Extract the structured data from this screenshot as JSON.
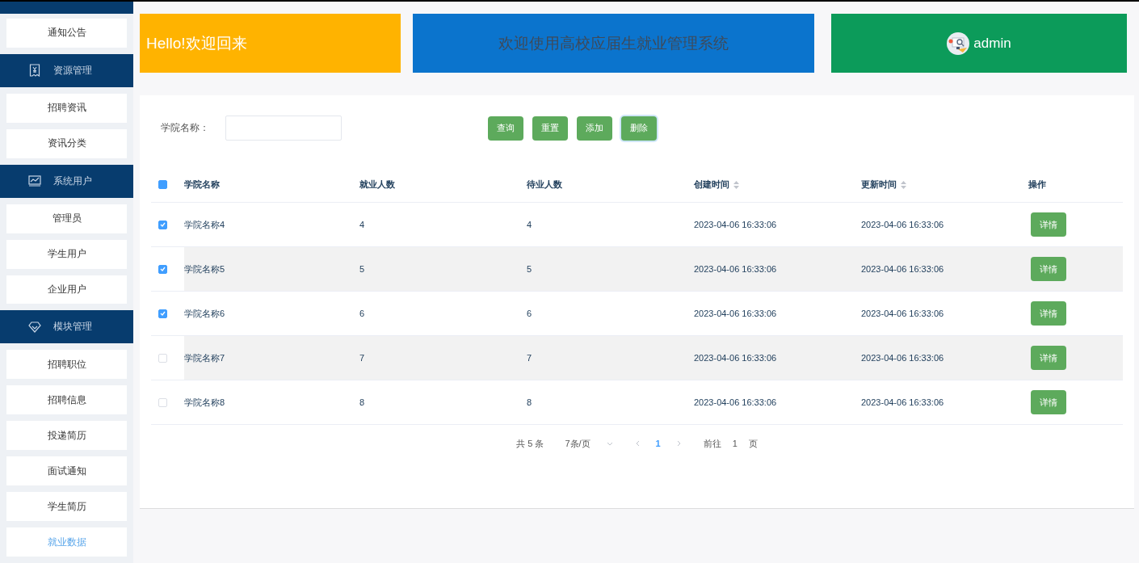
{
  "sidebar": {
    "items": [
      {
        "kind": "item",
        "label": "通知公告",
        "selected": false
      },
      {
        "kind": "group",
        "label": "资源管理"
      },
      {
        "kind": "item",
        "label": "招聘资讯",
        "selected": false
      },
      {
        "kind": "item",
        "label": "资讯分类",
        "selected": false
      },
      {
        "kind": "group",
        "label": "系统用户"
      },
      {
        "kind": "item",
        "label": "管理员",
        "selected": false
      },
      {
        "kind": "item",
        "label": "学生用户",
        "selected": false
      },
      {
        "kind": "item",
        "label": "企业用户",
        "selected": false
      },
      {
        "kind": "group",
        "label": "模块管理"
      },
      {
        "kind": "item",
        "label": "招聘职位",
        "selected": false
      },
      {
        "kind": "item",
        "label": "招聘信息",
        "selected": false
      },
      {
        "kind": "item",
        "label": "投递简历",
        "selected": false
      },
      {
        "kind": "item",
        "label": "面试通知",
        "selected": false
      },
      {
        "kind": "item",
        "label": "学生简历",
        "selected": false
      },
      {
        "kind": "item",
        "label": "就业数据",
        "selected": true
      }
    ]
  },
  "banners": [
    {
      "kind": "welcome",
      "text": "Hello!欢迎回来",
      "color": "#ffb300"
    },
    {
      "kind": "title",
      "text": "欢迎使用高校应届生就业管理系统",
      "color": "#0b74cd"
    },
    {
      "kind": "user",
      "text": "admin",
      "color": "#0c9b5a"
    }
  ],
  "search": {
    "label": "学院名称："
  },
  "buttons": [
    {
      "label": "查询",
      "focused": false
    },
    {
      "label": "重置",
      "focused": false
    },
    {
      "label": "添加",
      "focused": false
    },
    {
      "label": "删除",
      "focused": true
    }
  ],
  "table": {
    "select_all_indeterminate": true,
    "columns": [
      {
        "label": "学院名称",
        "sortable": false
      },
      {
        "label": "就业人数",
        "sortable": false
      },
      {
        "label": "待业人数",
        "sortable": false
      },
      {
        "label": "创建时间",
        "sortable": true
      },
      {
        "label": "更新时间",
        "sortable": true
      },
      {
        "label": "操作",
        "sortable": false
      }
    ],
    "rows": [
      {
        "checked": true,
        "cells": [
          "学院名称4",
          "4",
          "4",
          "2023-04-06 16:33:06",
          "2023-04-06 16:33:06"
        ],
        "action": "详情"
      },
      {
        "checked": true,
        "cells": [
          "学院名称5",
          "5",
          "5",
          "2023-04-06 16:33:06",
          "2023-04-06 16:33:06"
        ],
        "action": "详情"
      },
      {
        "checked": true,
        "cells": [
          "学院名称6",
          "6",
          "6",
          "2023-04-06 16:33:06",
          "2023-04-06 16:33:06"
        ],
        "action": "详情"
      },
      {
        "checked": false,
        "cells": [
          "学院名称7",
          "7",
          "7",
          "2023-04-06 16:33:06",
          "2023-04-06 16:33:06"
        ],
        "action": "详情"
      },
      {
        "checked": false,
        "cells": [
          "学院名称8",
          "8",
          "8",
          "2023-04-06 16:33:06",
          "2023-04-06 16:33:06"
        ],
        "action": "详情"
      }
    ]
  },
  "pagination": {
    "total": "共 5 条",
    "page_size": "7条/页",
    "pages": [
      {
        "label": "1",
        "selected": true
      }
    ],
    "jump_label": "前往",
    "jump_value": "1",
    "jump_suffix": "页"
  }
}
